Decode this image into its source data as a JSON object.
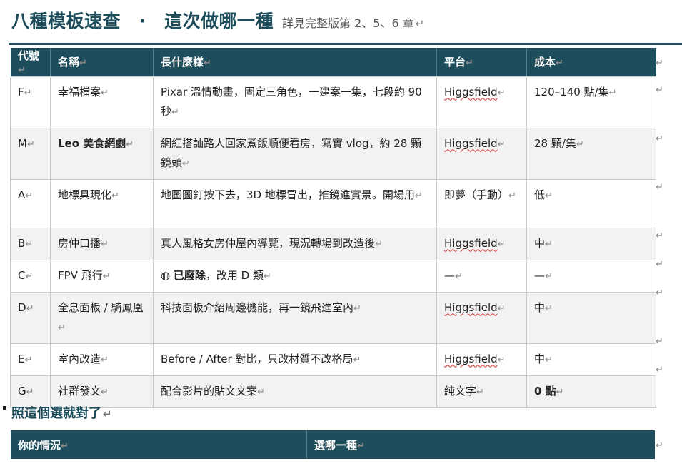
{
  "header": {
    "title": "八種模板速查　·　這次做哪一種",
    "subtitle": "詳見完整版第 2、5、6 章"
  },
  "para_mark": "↵",
  "templates_table": {
    "columns": [
      "代號",
      "名稱",
      "長什麼樣",
      "平台",
      "成本"
    ],
    "rows": [
      {
        "code": "F",
        "name": "幸福檔案",
        "desc": "Pixar 溫情動畫，固定三角色，一建案一集，七段約 90 秒",
        "platform": "Higgsfield",
        "cost": "120–140 點/集"
      },
      {
        "code": "M",
        "name": "Leo 美食網劇",
        "desc": "網紅搭訕路人回家煮飯順便看房，寫實 vlog，約 28 顆鏡頭",
        "platform": "Higgsfield",
        "cost": "28 顆/集"
      },
      {
        "code": "A",
        "name": "地標具現化",
        "desc": "地圖圖釘按下去，3D 地標冒出，推鏡進實景。開場用",
        "platform": "即夢（手動）",
        "cost": "低"
      },
      {
        "code": "B",
        "name": "房仲口播",
        "desc": "真人風格女房仲屋內導覽，現況轉場到改造後",
        "platform": "Higgsfield",
        "cost": "中"
      },
      {
        "code": "C",
        "name": "FPV 飛行",
        "desc_icon": "◍",
        "desc_bold": "已廢除",
        "desc": "，改用 D 類",
        "platform": "—",
        "cost": "—"
      },
      {
        "code": "D",
        "name": "全息面板 / 騎鳳凰",
        "desc": "科技面板介紹周邊機能，再一鏡飛進室內",
        "platform": "Higgsfield",
        "cost": "中"
      },
      {
        "code": "E",
        "name": "室內改造",
        "desc": "Before / After 對比，只改材質不改格局",
        "platform": "Higgsfield",
        "cost": "中"
      },
      {
        "code": "G",
        "name": "社群發文",
        "desc": "配合影片的貼文文案",
        "platform": "純文字",
        "cost": "0 點"
      }
    ]
  },
  "section2": {
    "heading": "照這個選就對了",
    "columns": [
      "你的情況",
      "選哪一種"
    ]
  }
}
